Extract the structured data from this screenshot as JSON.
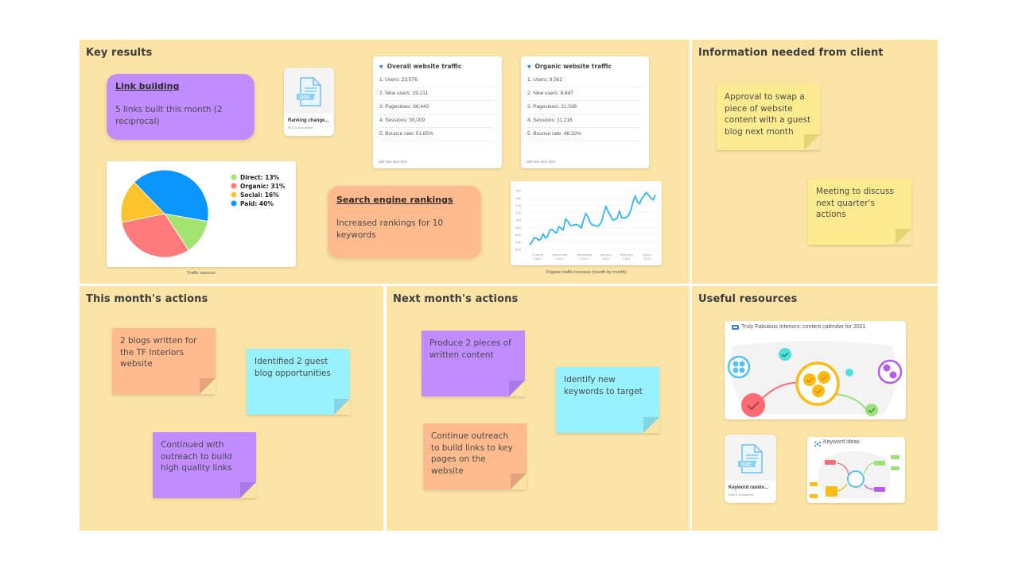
{
  "frames": {
    "key_results": {
      "title": "Key results"
    },
    "info_needed": {
      "title": "Information needed from client"
    },
    "this_month": {
      "title": "This month's actions"
    },
    "next_month": {
      "title": "Next month's actions"
    },
    "resources": {
      "title": "Useful resources"
    }
  },
  "key_results": {
    "link_building": {
      "title": "Link building",
      "body": "5 links built this month (2 reciprocal)",
      "color": "#c08cff"
    },
    "search_rankings": {
      "title": "Search engine rankings",
      "body": "Increased rankings for 10 keywords",
      "color": "#ffbb8e"
    },
    "doc_card": {
      "name": "Ranking change...",
      "type": "DOCX Document",
      "icon": "doc-file-icon"
    },
    "overall_traffic": {
      "title": "Overall website traffic",
      "items": [
        "1.  Users: 23,576",
        "2.  New users: 19,211",
        "3.  Pageviews: 68,443",
        "4.  Sessions: 35,009",
        "5.  Bounce rate: 51.65%"
      ],
      "add_label": "Add new item here"
    },
    "organic_traffic": {
      "title": "Organic website traffic",
      "items": [
        "1.  Users: 9,562",
        "2.  New users: 8,647",
        "3.  Pageviews: 21,038",
        "4.  Sessions: 11,216",
        "5.  Bounce rate: 48.32%"
      ],
      "add_label": "Add new item here"
    },
    "pie_caption": "Traffic sources",
    "line_caption": "Organic traffic increase (month by month)"
  },
  "chart_data": [
    {
      "type": "pie",
      "title": "Traffic sources",
      "categories": [
        "Direct",
        "Organic",
        "Social",
        "Paid"
      ],
      "values": [
        13,
        31,
        16,
        40
      ],
      "labels": [
        "Direct: 13%",
        "Organic: 31%",
        "Social: 16%",
        "Paid: 40%"
      ],
      "colors": [
        "#a3e36f",
        "#ff7b7b",
        "#fcc32b",
        "#0b96ff"
      ],
      "legend": "right"
    },
    {
      "type": "line",
      "title": "Organic traffic increase (month by month)",
      "xlabel": "",
      "ylabel": "",
      "ylim": [
        620,
        780
      ],
      "yticks": [
        620,
        640,
        660,
        680,
        700,
        720,
        740,
        760,
        780
      ],
      "xticks": [
        "October\n2020",
        "November\n2020",
        "December\n2020",
        "January\n2021",
        "February\n2021",
        "March\n2021"
      ],
      "grid": true,
      "color": "#2fb7f5",
      "series": [
        {
          "name": "Organic traffic",
          "values": [
            633,
            640,
            652,
            651,
            645,
            648,
            662,
            651,
            655,
            673,
            675,
            668,
            665,
            682,
            678,
            673,
            703,
            697,
            686,
            685,
            687,
            688,
            684,
            678,
            700,
            718,
            708,
            693,
            686,
            686,
            683,
            686,
            695,
            718,
            737,
            723,
            712,
            700,
            702,
            705,
            725,
            706,
            706,
            707,
            712,
            725,
            748,
            766,
            750,
            744,
            760,
            766,
            775,
            768,
            760,
            755,
            768
          ]
        }
      ]
    }
  ],
  "info_needed": {
    "notes": [
      {
        "text": "Approval to swap a piece of website content with a guest blog next month",
        "color": "#fdec8f"
      },
      {
        "text": "Meeting to discuss next quarter's actions",
        "color": "#fdec8f"
      }
    ]
  },
  "this_month": {
    "notes": [
      {
        "text": "2 blogs written for the TF Interiors website",
        "color": "#ffbb8e"
      },
      {
        "text": "Identified 2 guest blog opportunities",
        "color": "#98f1fe"
      },
      {
        "text": "Continued with outreach to build high quality links",
        "color": "#c08cff"
      }
    ]
  },
  "next_month": {
    "notes": [
      {
        "text": "Produce 2 pieces of written content",
        "color": "#c08cff"
      },
      {
        "text": "Identify new keywords to target",
        "color": "#98f1fe"
      },
      {
        "text": "Continue outreach to build links to key pages on the website",
        "color": "#ffbb8e"
      }
    ]
  },
  "resources": {
    "calendar_board": {
      "title": "Truly Fabulous Interiors: content calendar for 2021",
      "icon": "board-icon"
    },
    "doc_card": {
      "name": "Keyword rankin...",
      "type": "DOCX Document",
      "icon": "doc-file-icon"
    },
    "mindmap_board": {
      "title": "Keyword ideas",
      "icon": "mindmap-icon"
    }
  }
}
